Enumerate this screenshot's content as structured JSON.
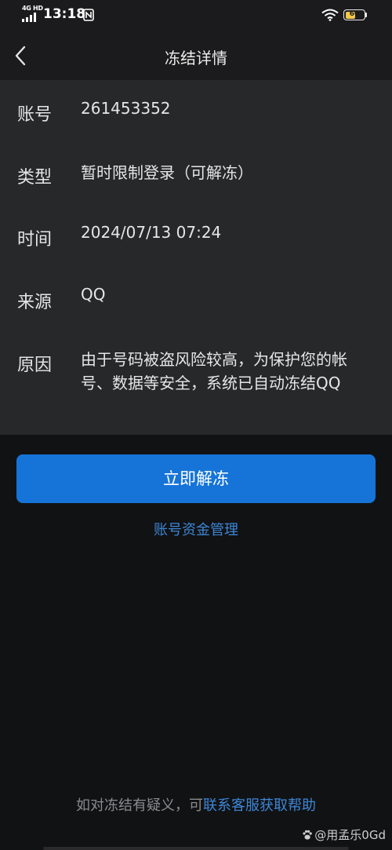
{
  "status_bar": {
    "network": "4G HD",
    "time": "13:18",
    "battery_text": "60",
    "battery_level": 0.6,
    "icons": [
      "signal-icon",
      "nfc-icon",
      "wifi-icon",
      "battery-icon"
    ]
  },
  "nav": {
    "title": "冻结详情",
    "back_icon": "chevron-left-icon"
  },
  "details": {
    "account_label": "账号",
    "account_value": "261453352",
    "type_label": "类型",
    "type_value": "暂时限制登录（可解冻）",
    "time_label": "时间",
    "time_value": "2024/07/13 07:24",
    "source_label": "来源",
    "source_value": "QQ",
    "reason_label": "原因",
    "reason_value": "由于号码被盗风险较高，为保护您的帐号、数据等安全，系统已自动冻结QQ"
  },
  "actions": {
    "unfreeze_label": "立即解冻",
    "funds_link": "账号资金管理"
  },
  "footer": {
    "help_prefix": "如对冻结有疑义，可",
    "help_link": "联系客服获取帮助"
  },
  "watermark": {
    "text": "@用孟乐0Gd"
  },
  "colors": {
    "accent": "#1674d8",
    "link": "#3d86d6",
    "card_bg": "#27282a",
    "page_bg": "#111214",
    "battery": "#f2c84b"
  }
}
